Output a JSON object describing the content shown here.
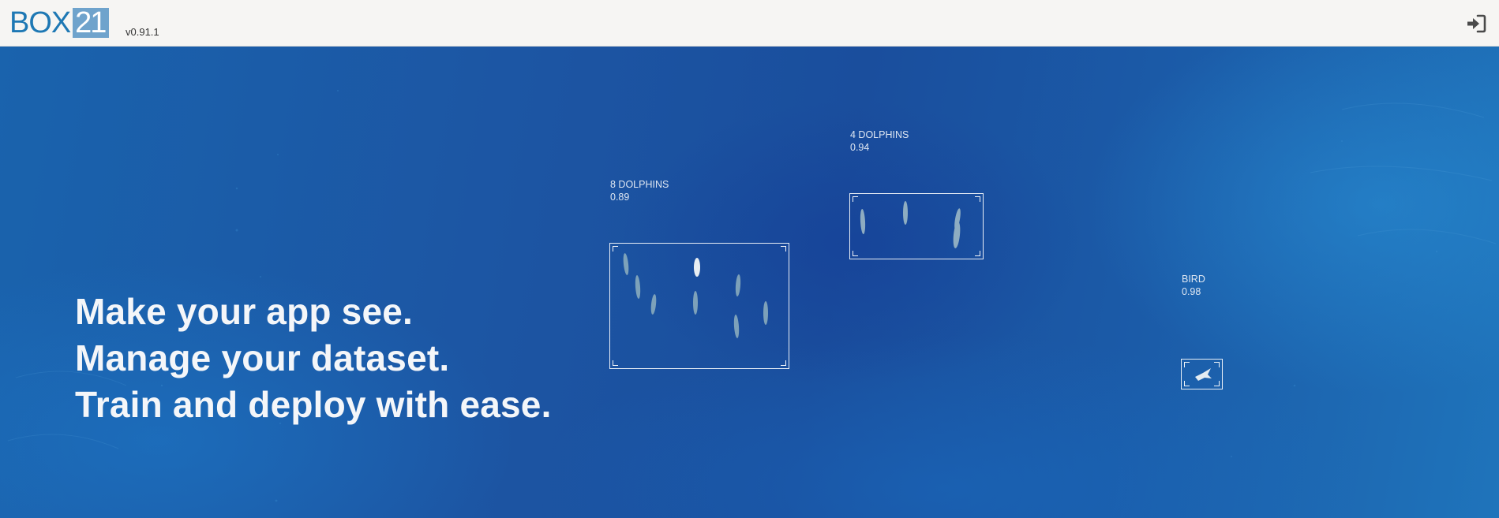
{
  "header": {
    "logo_text": "BOX",
    "logo_number": "21",
    "version": "v0.91.1",
    "login_icon": "sign-in-icon",
    "brand_color": "#1e78b4",
    "brand_box_color": "#6fa3cc"
  },
  "hero": {
    "taglines": [
      "Make your app see.",
      "Manage your dataset.",
      "Train and deploy with ease."
    ],
    "detections": [
      {
        "label": "8 DOLPHINS",
        "score": "0.89"
      },
      {
        "label": "4 DOLPHINS",
        "score": "0.94"
      },
      {
        "label": "BIRD",
        "score": "0.98"
      }
    ],
    "background_color": "#1c55a3"
  }
}
